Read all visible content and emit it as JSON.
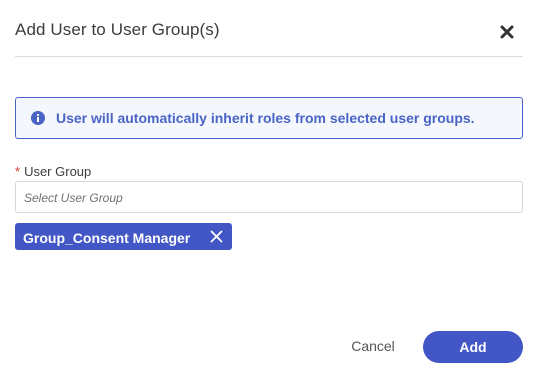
{
  "dialog": {
    "title": "Add User to User Group(s)",
    "close_icon": "close-icon"
  },
  "info_banner": {
    "icon": "info-circle-icon",
    "text": "User will automatically inherit roles from selected user groups."
  },
  "user_group_field": {
    "required_marker": "*",
    "label": "User Group",
    "placeholder": "Select User Group",
    "selected_tags": [
      {
        "label": "Group_Consent Manager",
        "remove_icon": "close-icon"
      }
    ]
  },
  "footer": {
    "cancel_label": "Cancel",
    "add_label": "Add"
  },
  "colors": {
    "accent": "#4256c5",
    "info_border": "#4a64c6",
    "info_background": "#f4f7fd",
    "required": "#d9342b"
  }
}
